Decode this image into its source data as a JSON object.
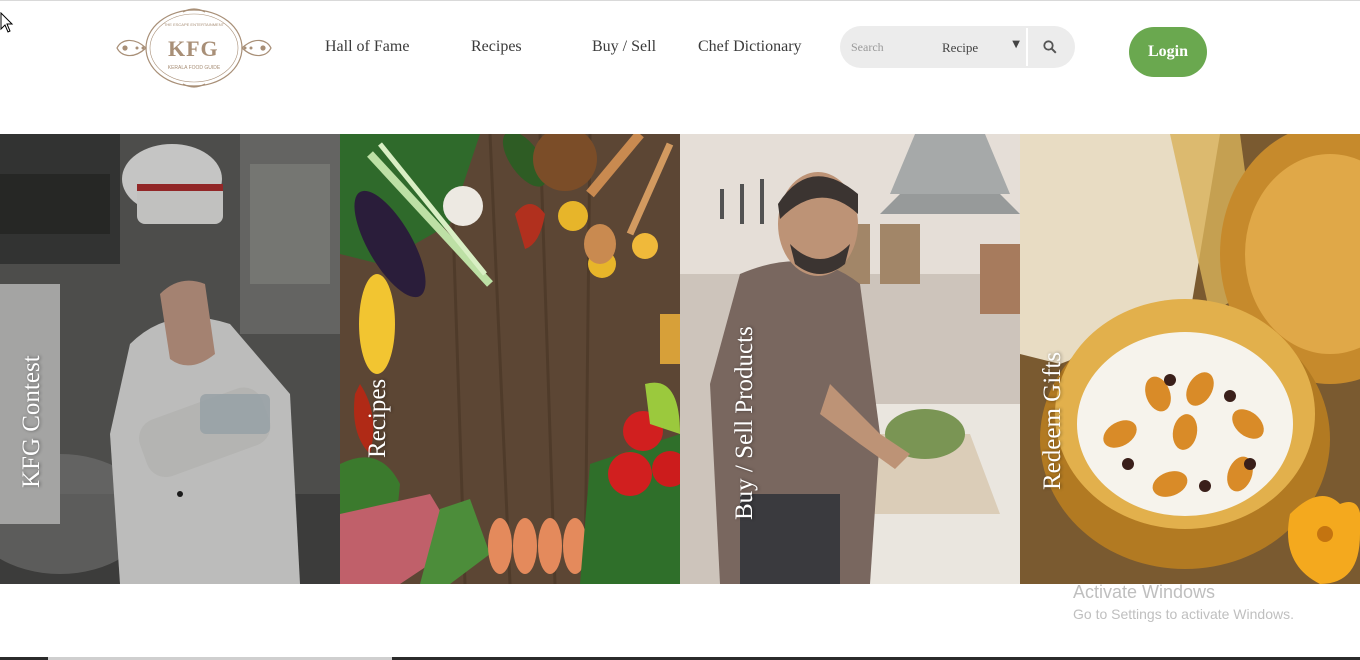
{
  "header": {
    "logo": {
      "monogram": "KFG",
      "top_text": "THE ESCAPE ENTERTAINMENT",
      "bottom_text": "KERALA FOOD GUIDE"
    },
    "nav": [
      {
        "label": "Hall of Fame"
      },
      {
        "label": "Recipes"
      },
      {
        "label": "Buy / Sell"
      },
      {
        "label": "Chef Dictionary"
      }
    ],
    "search": {
      "placeholder": "Search",
      "category": "Recipe",
      "icon": "search-icon"
    },
    "login_label": "Login",
    "colors": {
      "login_bg": "#6aa84f",
      "search_bg": "#ececec"
    }
  },
  "tiles": [
    {
      "label": "KFG Contest",
      "image": "chef-cooking-photo"
    },
    {
      "label": "Recipes",
      "image": "vegetables-on-wood-photo"
    },
    {
      "label": "Buy / Sell Products",
      "image": "man-cutting-vegetables-photo"
    },
    {
      "label": "Redeem Gifts",
      "image": "payasam-in-brass-bowl-photo"
    }
  ],
  "watermark": {
    "title": "Activate Windows",
    "subtitle": "Go to Settings to activate Windows."
  }
}
